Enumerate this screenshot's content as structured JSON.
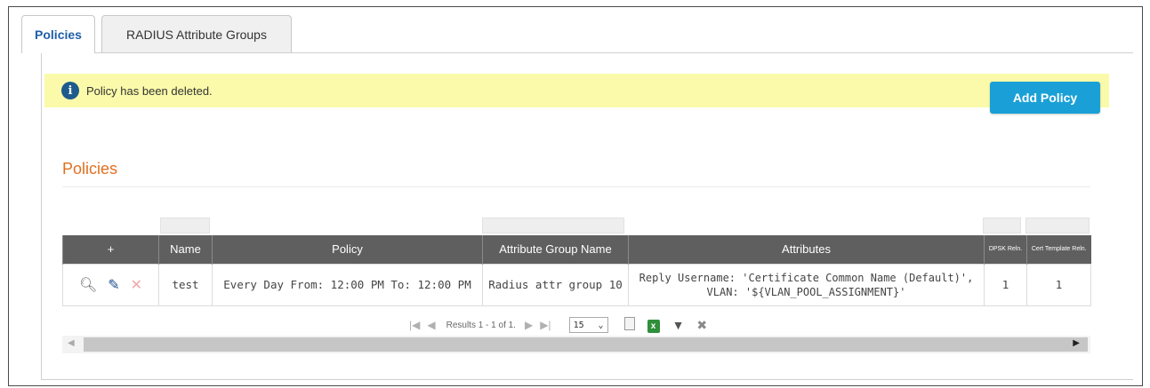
{
  "tabs": [
    {
      "label": "Policies",
      "active": true
    },
    {
      "label": "RADIUS Attribute Groups",
      "active": false
    }
  ],
  "alert": {
    "icon": "info-icon",
    "text": "Policy has been deleted."
  },
  "toolbar": {
    "add_label": "Add Policy"
  },
  "section": {
    "title": "Policies"
  },
  "table": {
    "columns": [
      "+",
      "Name",
      "Policy",
      "Attribute Group Name",
      "Attributes",
      "DPSK Reln.",
      "Cert Template Reln."
    ],
    "rows": [
      {
        "name": "test",
        "policy": "Every Day From: 12:00 PM To: 12:00 PM",
        "attribute_group": "Radius attr group 10",
        "attributes_line1": "Reply Username: 'Certificate Common Name (Default)',",
        "attributes_line2": "VLAN: '${VLAN_POOL_ASSIGNMENT}'",
        "dpsk": "1",
        "cert": "1"
      }
    ]
  },
  "pager": {
    "results": "Results 1 - 1 of 1.",
    "page_size": "15"
  },
  "colors": {
    "accent": "#1aa0d6",
    "section_title": "#e0701f",
    "alert_bg": "#fafaaa",
    "header_bg": "#5f5f5f",
    "tab_active": "#1f5fa8"
  }
}
